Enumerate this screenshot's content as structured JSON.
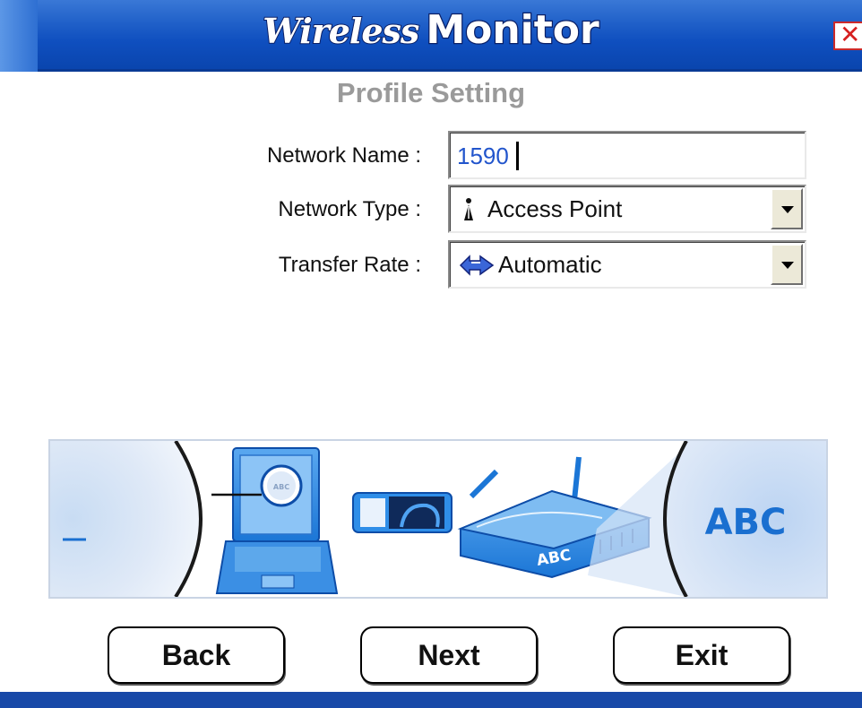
{
  "window": {
    "title_script": "Wireless",
    "title_main": "Monitor",
    "close_glyph": "✕"
  },
  "page": {
    "section_title": "Profile Setting"
  },
  "form": {
    "network_name_label": "Network Name :",
    "network_name_value": "1590",
    "network_type_label": "Network Type :",
    "network_type_value": "Access Point",
    "network_type_icon": "access-point-icon",
    "transfer_rate_label": "Transfer Rate :",
    "transfer_rate_value": "Automatic",
    "transfer_rate_icon": "double-arrow-icon"
  },
  "banner": {
    "abc_large": "ABC",
    "abc_router": "ABC",
    "abc_lens": "ABC",
    "accent": "#1a6fd0"
  },
  "buttons": {
    "back": "Back",
    "next": "Next",
    "exit": "Exit"
  },
  "colors": {
    "titlebar": "#1f5fc8",
    "close_red": "#d62020",
    "section_title": "#9a9a9a",
    "input_text": "#2255cc"
  }
}
